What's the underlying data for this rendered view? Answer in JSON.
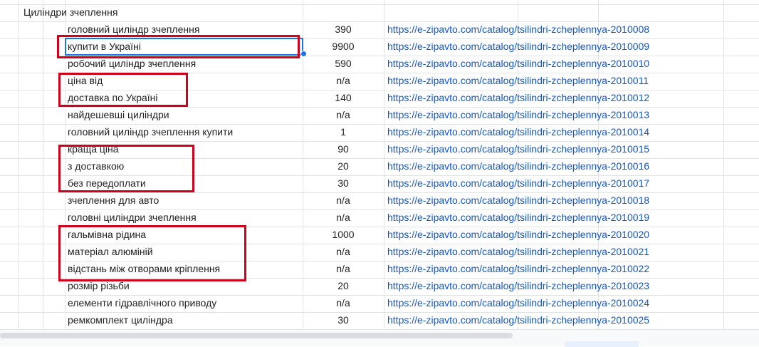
{
  "sheet": {
    "section_title": "Циліндри зчеплення",
    "rows": [
      {
        "label": "головний циліндр зчеплення",
        "price": "390",
        "url": "https://e-zipavto.com/catalog/tsilindri-zcheplennya-2010008"
      },
      {
        "label": "купити в Україні",
        "price": "9900",
        "url": "https://e-zipavto.com/catalog/tsilindri-zcheplennya-2010009"
      },
      {
        "label": "робочий циліндр зчеплення",
        "price": "590",
        "url": "https://e-zipavto.com/catalog/tsilindri-zcheplennya-2010010"
      },
      {
        "label": "ціна від",
        "price": "n/a",
        "url": "https://e-zipavto.com/catalog/tsilindri-zcheplennya-2010011"
      },
      {
        "label": "доставка по Україні",
        "price": "140",
        "url": "https://e-zipavto.com/catalog/tsilindri-zcheplennya-2010012"
      },
      {
        "label": "найдешевші циліндри",
        "price": "n/a",
        "url": "https://e-zipavto.com/catalog/tsilindri-zcheplennya-2010013"
      },
      {
        "label": "головний циліндр зчеплення купити",
        "price": "1",
        "url": "https://e-zipavto.com/catalog/tsilindri-zcheplennya-2010014"
      },
      {
        "label": "краща ціна",
        "price": "90",
        "url": "https://e-zipavto.com/catalog/tsilindri-zcheplennya-2010015"
      },
      {
        "label": "з доставкою",
        "price": "20",
        "url": "https://e-zipavto.com/catalog/tsilindri-zcheplennya-2010016"
      },
      {
        "label": "без передоплати",
        "price": "30",
        "url": "https://e-zipavto.com/catalog/tsilindri-zcheplennya-2010017"
      },
      {
        "label": "зчеплення для авто",
        "price": "n/a",
        "url": "https://e-zipavto.com/catalog/tsilindri-zcheplennya-2010018"
      },
      {
        "label": "головні циліндри зчеплення",
        "price": "n/a",
        "url": "https://e-zipavto.com/catalog/tsilindri-zcheplennya-2010019"
      },
      {
        "label": "гальмівна рідина",
        "price": "1000",
        "url": "https://e-zipavto.com/catalog/tsilindri-zcheplennya-2010020"
      },
      {
        "label": "матеріал алюміній",
        "price": "n/a",
        "url": "https://e-zipavto.com/catalog/tsilindri-zcheplennya-2010021"
      },
      {
        "label": "відстань між отворами кріплення",
        "price": "n/a",
        "url": "https://e-zipavto.com/catalog/tsilindri-zcheplennya-2010022"
      },
      {
        "label": "розмір різьби",
        "price": "20",
        "url": "https://e-zipavto.com/catalog/tsilindri-zcheplennya-2010023"
      },
      {
        "label": "елементи гідравлічного приводу",
        "price": "n/a",
        "url": "https://e-zipavto.com/catalog/tsilindri-zcheplennya-2010024"
      },
      {
        "label": "ремкомплект циліндра",
        "price": "30",
        "url": "https://e-zipavto.com/catalog/tsilindri-zcheplennya-2010025"
      }
    ],
    "selected_row": 1,
    "highlight_groups": [
      [
        1
      ],
      [
        3,
        4
      ],
      [
        7,
        8,
        9
      ],
      [
        12,
        13,
        14
      ]
    ]
  },
  "colors": {
    "link": "#1155cc",
    "highlight_border": "#d0021b",
    "selection": "#1a73e8",
    "gridline": "#e2e3e3"
  }
}
